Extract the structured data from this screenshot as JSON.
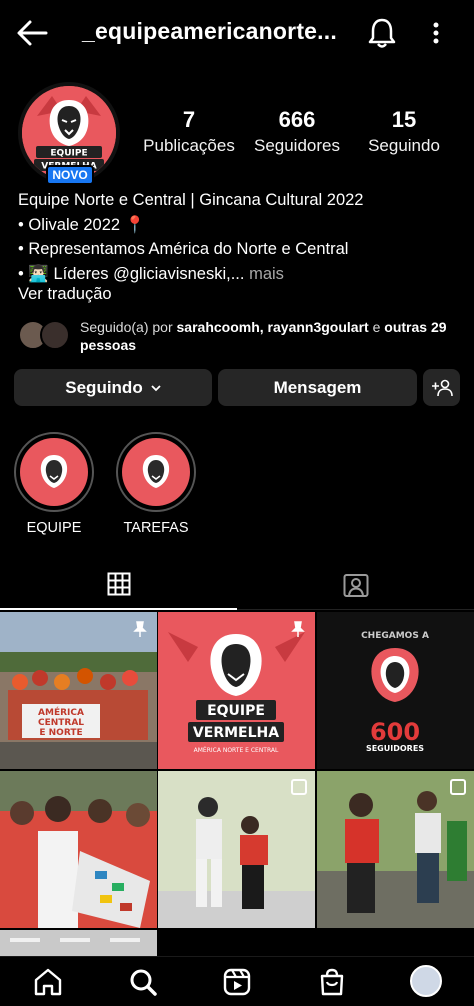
{
  "header": {
    "username": "_equipeamericanorte..."
  },
  "profile": {
    "badge": "NOVO",
    "avatar_text": [
      "EQUIPE",
      "VERMELHA"
    ],
    "stats": [
      {
        "value": "7",
        "label": "Publicações"
      },
      {
        "value": "666",
        "label": "Seguidores"
      },
      {
        "value": "15",
        "label": "Seguindo"
      }
    ],
    "bio": {
      "name": "Equipe Norte e Central | Gincana Cultural 2022",
      "line1": "• Olivale 2022 📍",
      "line2": "• Representamos América do Norte e Central",
      "line3": "• 👨🏻‍💻 Líderes @gliciavisneski,...",
      "more": " mais"
    },
    "translate": "Ver tradução",
    "followed_by": {
      "prefix": "Seguido(a) por ",
      "users": "sarahcoomh, rayann3goulart",
      "middle": " e ",
      "suffix": "outras 29 pessoas"
    }
  },
  "actions": {
    "following": "Seguindo",
    "message": "Mensagem"
  },
  "highlights": [
    {
      "label": "EQUIPE"
    },
    {
      "label": "TAREFAS"
    }
  ],
  "posts": {
    "p1_text": [
      "AMÉRICA",
      "CENTRAL",
      "E NORTE"
    ],
    "p2_text": [
      "EQUIPE",
      "VERMELHA",
      "AMÉRICA NORTE E CENTRAL"
    ],
    "p3_text": [
      "CHEGAMOS A",
      "600",
      "SEGUIDORES"
    ]
  },
  "colors": {
    "brand_red": "#e9585e",
    "button_bg": "#262626",
    "badge_blue": "#1877f2"
  }
}
